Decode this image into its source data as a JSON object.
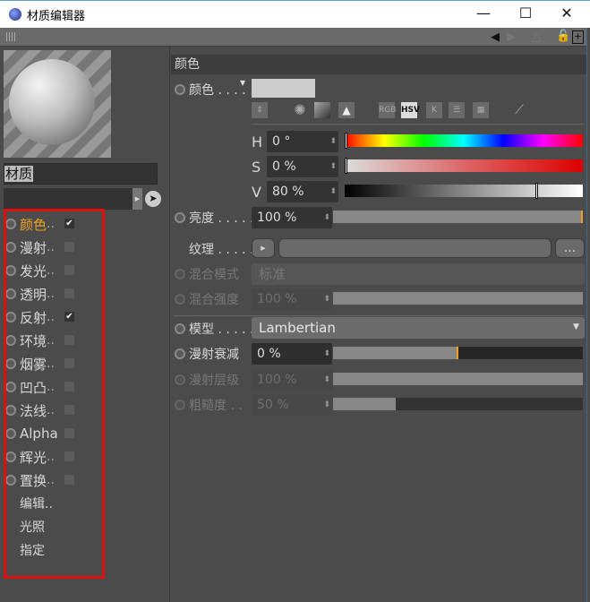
{
  "window": {
    "title": "材质编辑器",
    "minimize": "—",
    "maximize": "☐",
    "close": "✕"
  },
  "material": {
    "name": "材质"
  },
  "channels": [
    {
      "label": "颜色",
      "suffix": "..",
      "checked": true,
      "active": true
    },
    {
      "label": "漫射",
      "suffix": "..",
      "checked": false
    },
    {
      "label": "发光",
      "suffix": "..",
      "checked": false
    },
    {
      "label": "透明",
      "suffix": "..",
      "checked": false
    },
    {
      "label": "反射",
      "suffix": "..",
      "checked": true
    },
    {
      "label": "环境",
      "suffix": "..",
      "checked": false
    },
    {
      "label": "烟雾",
      "suffix": "..",
      "checked": false
    },
    {
      "label": "凹凸",
      "suffix": "..",
      "checked": false
    },
    {
      "label": "法线",
      "suffix": "..",
      "checked": false
    },
    {
      "label": "Alpha",
      "suffix": "",
      "checked": false
    },
    {
      "label": "辉光",
      "suffix": "..",
      "checked": false
    },
    {
      "label": "置换",
      "suffix": "..",
      "checked": false
    }
  ],
  "extra_items": [
    "编辑..",
    "光照",
    "指定"
  ],
  "section": {
    "title": "颜色"
  },
  "color": {
    "label": "颜色 . . . .",
    "swatch": "#cccccc",
    "modes": [
      "RGB",
      "HSV",
      "K"
    ],
    "H": {
      "label": "H",
      "value": "0 °"
    },
    "S": {
      "label": "S",
      "value": "0 %"
    },
    "V": {
      "label": "V",
      "value": "80 %",
      "fraction": 0.8
    }
  },
  "brightness": {
    "label": "亮度 . . . . .",
    "value": "100 %",
    "fraction": 1.0
  },
  "texture": {
    "label": "纹理 . . . . .",
    "more": "..."
  },
  "blend_mode": {
    "label": "混合模式",
    "value": "标准"
  },
  "blend_strength": {
    "label": "混合强度",
    "value": "100 %",
    "fraction": 1.0
  },
  "model": {
    "label": "模型 . . . . .",
    "value": "Lambertian"
  },
  "diffuse_falloff": {
    "label": "漫射衰减",
    "value": "0 %",
    "fraction": 0.5
  },
  "diffuse_level": {
    "label": "漫射层级",
    "value": "100 %",
    "fraction": 1.0
  },
  "roughness": {
    "label": "粗糙度 . .",
    "value": "50 %",
    "fraction": 0.25
  }
}
